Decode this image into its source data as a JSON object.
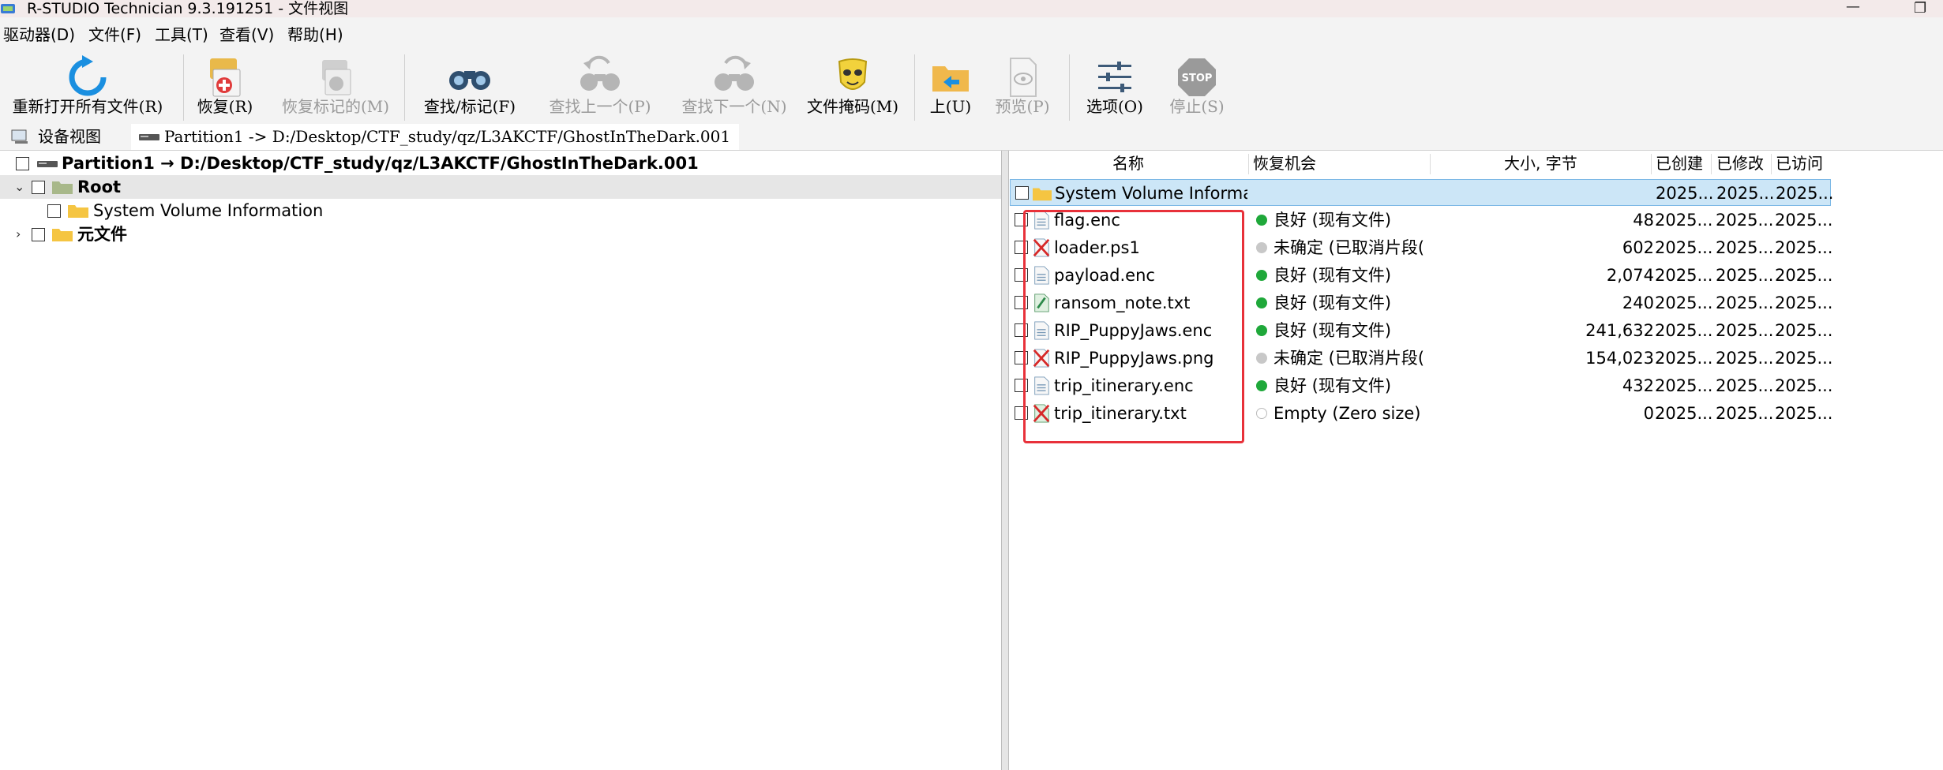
{
  "window": {
    "title": "R-STUDIO Technician 9.3.191251 - 文件视图",
    "minimize_glyph": "—",
    "restore_glyph": "❐"
  },
  "menu": [
    "驱动器(D)",
    "文件(F)",
    "工具(T)",
    "查看(V)",
    "帮助(H)"
  ],
  "toolbar": {
    "reopen": "重新打开所有文件(R)",
    "recover": "恢复(R)",
    "recover_marked": "恢复标记的(M)",
    "find_mark": "查找/标记(F)",
    "find_prev": "查找上一个(P)",
    "find_next": "查找下一个(N)",
    "file_mask": "文件掩码(M)",
    "up": "上(U)",
    "preview": "预览(P)",
    "options": "选项(O)",
    "stop": "停止(S)",
    "stop_icon_text": "STOP"
  },
  "tabs": {
    "device_view": "设备视图",
    "file_view": "Partition1 -> D:/Desktop/CTF_study/qz/L3AKCTF/GhostInTheDark.001"
  },
  "tree": {
    "partition": "Partition1 → D:/Desktop/CTF_study/qz/L3AKCTF/GhostInTheDark.001",
    "root": "Root",
    "svi": "System Volume Information",
    "meta": "元文件"
  },
  "columns": {
    "name": "名称",
    "chance": "恢复机会",
    "size": "大小, 字节",
    "created": "已创建",
    "modified": "已修改",
    "accessed": "已访问"
  },
  "files": [
    {
      "name": "System Volume Informa",
      "chance": "",
      "size": "",
      "created": "2025...",
      "modified": "2025...",
      "accessed": "2025...",
      "icon": "folder-icon",
      "status": ""
    },
    {
      "name": "flag.enc",
      "chance": "良好 (现有文件)",
      "size": "48",
      "created": "2025...",
      "modified": "2025...",
      "accessed": "2025...",
      "icon": "file-icon",
      "status": "good"
    },
    {
      "name": "loader.ps1",
      "chance": "未确定 (已取消片段(",
      "size": "602",
      "created": "2025...",
      "modified": "2025...",
      "accessed": "2025...",
      "icon": "deleted-file-icon",
      "status": "unknown"
    },
    {
      "name": "payload.enc",
      "chance": "良好 (现有文件)",
      "size": "2,074",
      "created": "2025...",
      "modified": "2025...",
      "accessed": "2025...",
      "icon": "file-icon",
      "status": "good"
    },
    {
      "name": "ransom_note.txt",
      "chance": "良好 (现有文件)",
      "size": "240",
      "created": "2025...",
      "modified": "2025...",
      "accessed": "2025...",
      "icon": "text-file-icon",
      "status": "good"
    },
    {
      "name": "RIP_PuppyJaws.enc",
      "chance": "良好 (现有文件)",
      "size": "241,632",
      "created": "2025...",
      "modified": "2025...",
      "accessed": "2025...",
      "icon": "file-icon",
      "status": "good"
    },
    {
      "name": "RIP_PuppyJaws.png",
      "chance": "未确定 (已取消片段(",
      "size": "154,023",
      "created": "2025...",
      "modified": "2025...",
      "accessed": "2025...",
      "icon": "deleted-file-icon",
      "status": "unknown"
    },
    {
      "name": "trip_itinerary.enc",
      "chance": "良好 (现有文件)",
      "size": "432",
      "created": "2025...",
      "modified": "2025...",
      "accessed": "2025...",
      "icon": "file-icon",
      "status": "good"
    },
    {
      "name": "trip_itinerary.txt",
      "chance": "Empty (Zero size)",
      "size": "0",
      "created": "2025...",
      "modified": "2025...",
      "accessed": "2025...",
      "icon": "deleted-text-file-icon",
      "status": "empty"
    }
  ],
  "colors": {
    "good": "#1fa83a",
    "unknown": "#c8c8c8",
    "highlight": "#e8313a",
    "selection": "#cce6f7"
  }
}
